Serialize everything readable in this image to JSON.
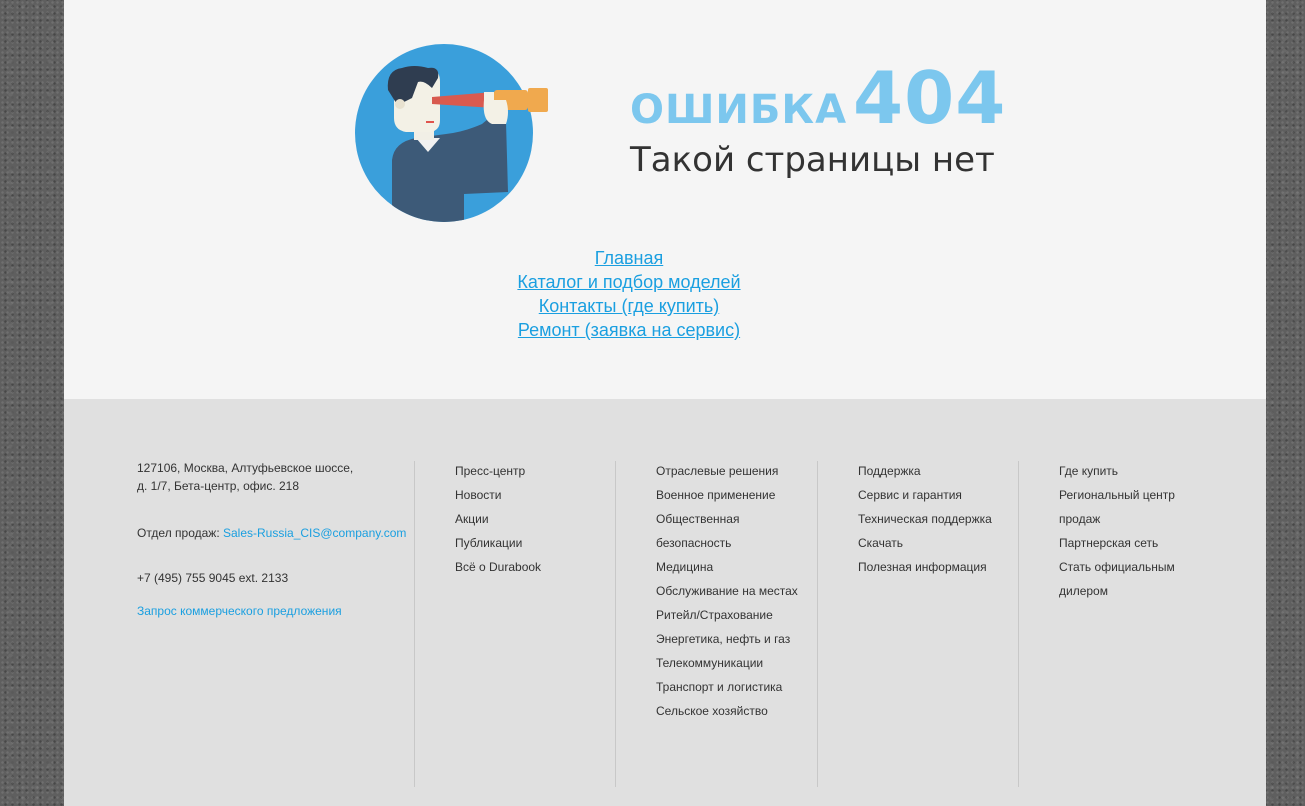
{
  "error": {
    "word": "ОШИБКА",
    "code": "404",
    "subtitle": "Такой страницы нет"
  },
  "nav_links": [
    "Главная",
    "Каталог и подбор моделей",
    "Контакты (где купить)",
    "Ремонт (заявка на сервис)"
  ],
  "footer": {
    "address_line1": "127106, Москва, Алтуфьевское шоссе,",
    "address_line2": "д. 1/7, Бета-центр, офис. 218",
    "sales_label": "Отдел продаж: ",
    "sales_email": "Sales-Russia_CIS@company.com",
    "phone": "+7 (495) 755 9045 ext. 2133",
    "request": "Запрос коммерческого предложения",
    "col2": [
      "Пресс-центр",
      "Новости",
      "Акции",
      "Публикации",
      "Всё о Durabook"
    ],
    "col3": [
      "Отраслевые решения",
      "Военное применение",
      "Общественная безопасность",
      "Медицина",
      "Обслуживание на местах",
      "Ритейл/Страхование",
      "Энергетика, нефть и газ",
      "Телекоммуникации",
      "Транспорт и логистика",
      "Сельское хозяйство"
    ],
    "col4": [
      "Поддержка",
      "Сервис и гарантия",
      "Техническая поддержка",
      "Скачать",
      "Полезная информация"
    ],
    "col5": [
      "Где купить",
      "Региональный центр продаж",
      "Партнерская сеть",
      "Стать официальным дилером"
    ]
  },
  "colors": {
    "accent": "#7cc7ee",
    "link": "#1a9fe0",
    "footer_bg": "#e0e0e0",
    "page_bg": "#f5f5f5"
  }
}
